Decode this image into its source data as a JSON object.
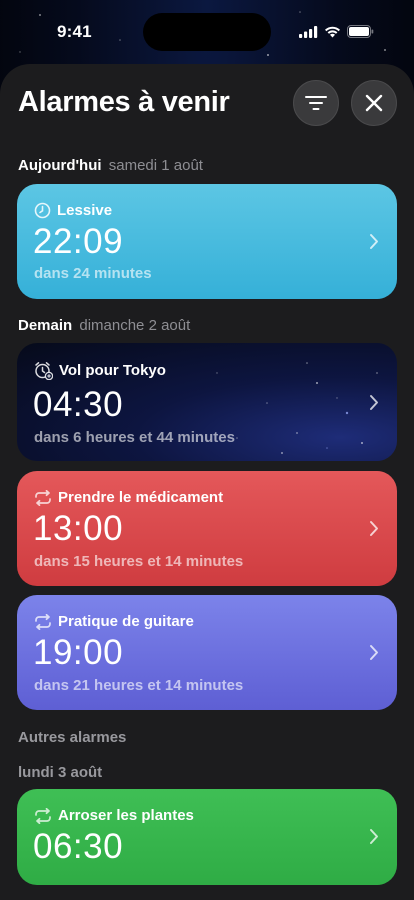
{
  "status_bar": {
    "time": "9:41"
  },
  "header": {
    "title": "Alarmes à venir"
  },
  "today": {
    "label": "Aujourd'hui",
    "date": "samedi 1 août"
  },
  "tomorrow": {
    "label": "Demain",
    "date": "dimanche 2 août"
  },
  "other": {
    "label": "Autres alarmes",
    "date": "lundi 3 août"
  },
  "alarms": [
    {
      "name": "Lessive",
      "time": "22:09",
      "remaining": "dans 24 minutes",
      "icon": "clock-icon",
      "color": "#44b9dd"
    },
    {
      "name": "Vol pour Tokyo",
      "time": "04:30",
      "remaining": "dans 6 heures et 44 minutes",
      "icon": "alarm-clock-plus-icon",
      "color": "#0a1230"
    },
    {
      "name": "Prendre le médicament",
      "time": "13:00",
      "remaining": "dans 15 heures et 14 minutes",
      "icon": "repeat-icon",
      "color": "#d94649"
    },
    {
      "name": "Pratique de guitare",
      "time": "19:00",
      "remaining": "dans 21 heures et 14 minutes",
      "icon": "repeat-icon",
      "color": "#6c70df"
    },
    {
      "name": "Arroser les plantes",
      "time": "06:30",
      "remaining": "",
      "icon": "repeat-icon",
      "color": "#36b54c"
    }
  ]
}
